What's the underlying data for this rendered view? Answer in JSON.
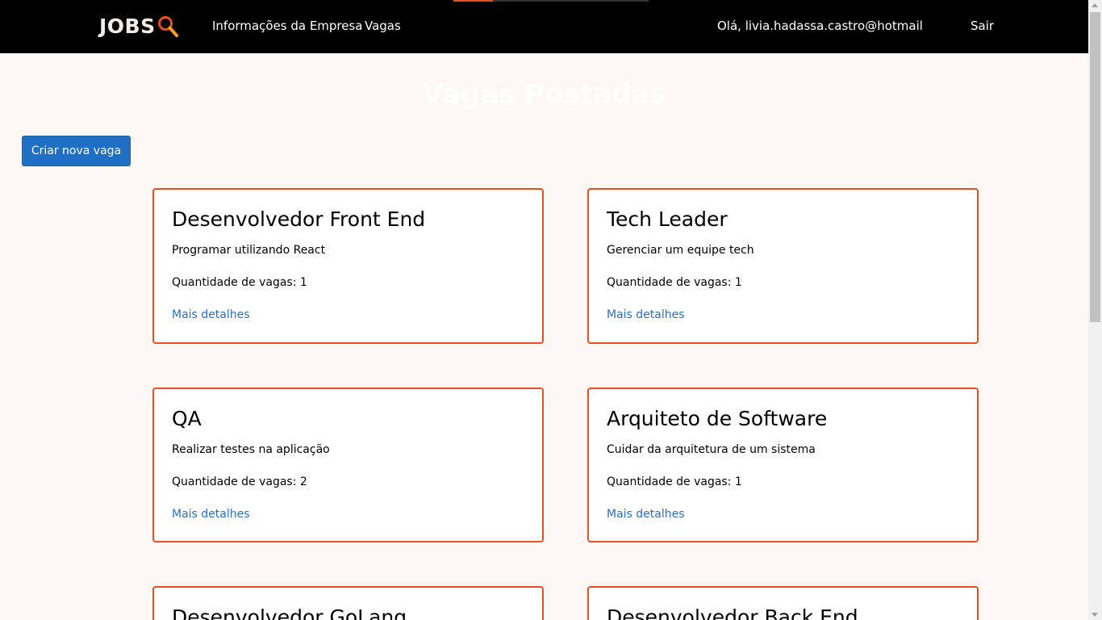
{
  "header": {
    "logo_text": "JOBS",
    "logo_icon": "magnifier-icon",
    "nav": [
      {
        "label": "Informações da Empresa"
      },
      {
        "label": "Vagas"
      }
    ],
    "greeting": "Olá, livia.hadassa.castro@hotmail",
    "logout_label": "Sair"
  },
  "main": {
    "title": "Vagas Postadas",
    "create_button_label": "Criar nova vaga",
    "jobs": [
      {
        "title": "Desenvolvedor Front End",
        "description": "Programar utilizando React",
        "quantity": "Quantidade de vagas: 1",
        "link_label": "Mais detalhes"
      },
      {
        "title": "Tech Leader",
        "description": "Gerenciar um equipe tech",
        "quantity": "Quantidade de vagas: 1",
        "link_label": "Mais detalhes"
      },
      {
        "title": "QA",
        "description": "Realizar testes na aplicação",
        "quantity": "Quantidade de vagas: 2",
        "link_label": "Mais detalhes"
      },
      {
        "title": "Arquiteto de Software",
        "description": "Cuidar da arquitetura de um sistema",
        "quantity": "Quantidade de vagas: 1",
        "link_label": "Mais detalhes"
      },
      {
        "title": "Desenvolvedor GoLang"
      },
      {
        "title": "Desenvolvedor Back End"
      }
    ]
  },
  "colors": {
    "accent": "#e8501e",
    "navbar_bg": "#000000",
    "page_bg": "#fdf7f5",
    "button_bg": "#1f6fc5",
    "link": "#2a6fc9"
  }
}
